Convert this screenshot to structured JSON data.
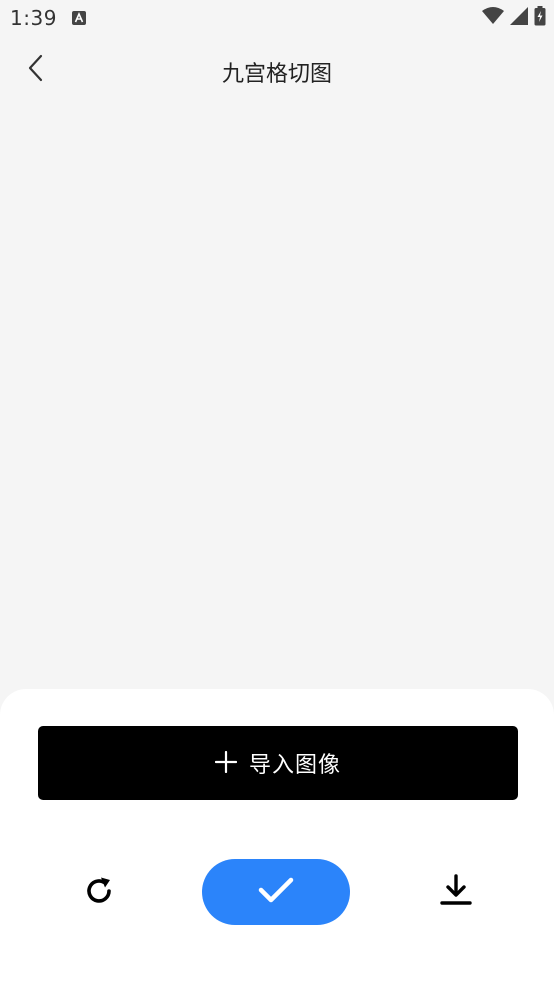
{
  "status_bar": {
    "time": "1:39",
    "app_icon": "text-a-icon",
    "wifi_icon": "wifi-icon",
    "signal_icon": "cell-signal-icon",
    "battery_icon": "battery-charging-icon"
  },
  "header": {
    "title": "九宫格切图",
    "back_icon": "chevron-left-icon"
  },
  "bottom_panel": {
    "import_button_label": "导入图像",
    "import_icon": "plus-icon",
    "reset_icon": "refresh-icon",
    "confirm_icon": "check-icon",
    "download_icon": "download-icon"
  },
  "colors": {
    "background": "#f5f5f5",
    "panel": "#ffffff",
    "import_button": "#000000",
    "confirm_button": "#2b84fa"
  }
}
